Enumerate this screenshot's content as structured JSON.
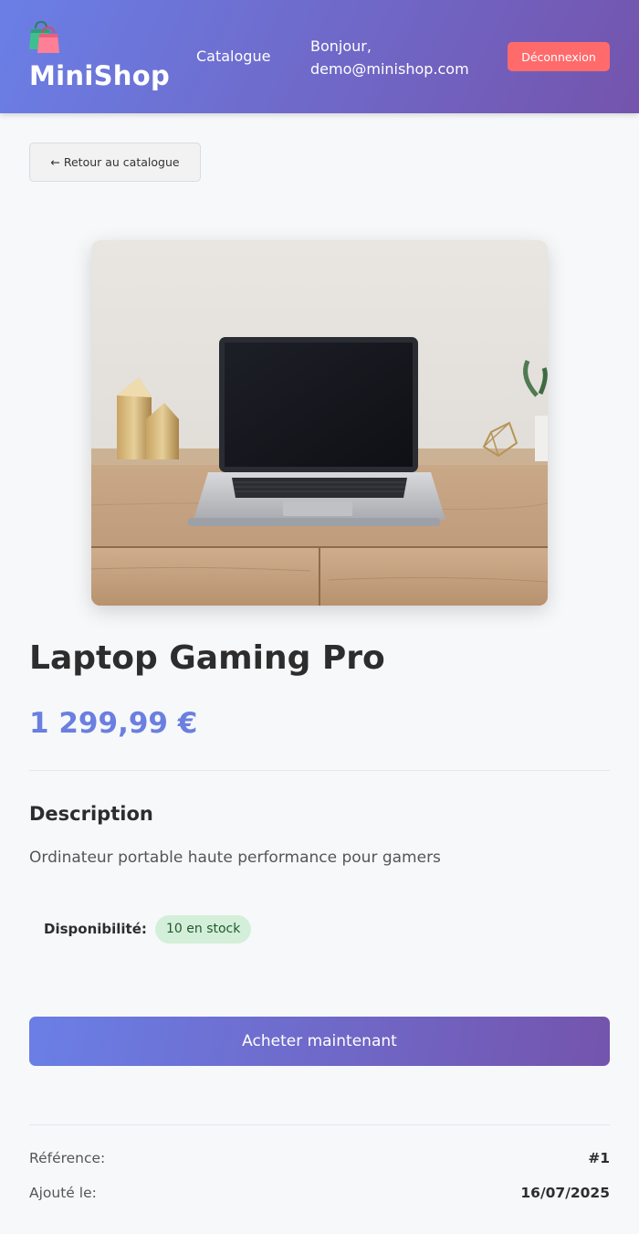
{
  "header": {
    "brand": "MiniShop",
    "nav_catalogue": "Catalogue",
    "greeting_line1": "Bonjour,",
    "greeting_line2": "demo@minishop.com",
    "logout_label": "Déconnexion",
    "logo_icon": "shopping-bags-icon"
  },
  "back_button": {
    "label": "← Retour au catalogue"
  },
  "product": {
    "image_icon": "laptop-on-desk-photo",
    "name": "Laptop Gaming Pro",
    "price": "1 299,99 €",
    "description_heading": "Description",
    "description": "Ordinateur portable haute performance pour gamers",
    "availability_label": "Disponibilité:",
    "stock_badge": "10 en stock",
    "buy_label": "Acheter maintenant",
    "reference_label": "Référence:",
    "reference_value": "#1",
    "added_label": "Ajouté le:",
    "added_value": "16/07/2025"
  },
  "colors": {
    "header_gradient_start": "#6a7fe6",
    "header_gradient_end": "#7454ad",
    "logout_bg": "#ff6b6b",
    "price": "#6a7fe0",
    "stock_badge_bg": "#d4efd9",
    "page_bg": "#f7f8fa"
  }
}
